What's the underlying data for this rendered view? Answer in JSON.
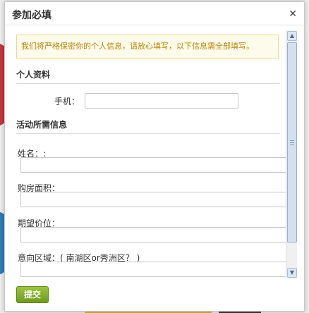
{
  "dialog": {
    "title": "参加必填",
    "close_icon": "✕",
    "notice": "我们将严格保密你的个人信息，请放心填写，以下信息需全部填写。"
  },
  "personal": {
    "heading": "个人资料",
    "phone_label": "手机：",
    "phone_value": ""
  },
  "activity": {
    "heading": "活动所需信息",
    "name_label": "姓名：:",
    "name_value": "",
    "area_label": "购房面积：",
    "area_value": "",
    "price_label": "期望价位：",
    "price_value": "",
    "region_label": "意向区域：( 南湖区or秀洲区？ )",
    "region_value": ""
  },
  "actions": {
    "submit_label": "提交"
  },
  "icons": {
    "close": "close-icon",
    "scroll_up": "chevron-up-icon",
    "scroll_down": "chevron-down-icon"
  },
  "colors": {
    "notice_text": "#b8860b",
    "notice_bg": "#fffbea",
    "submit_bg": "#7ea82a"
  }
}
